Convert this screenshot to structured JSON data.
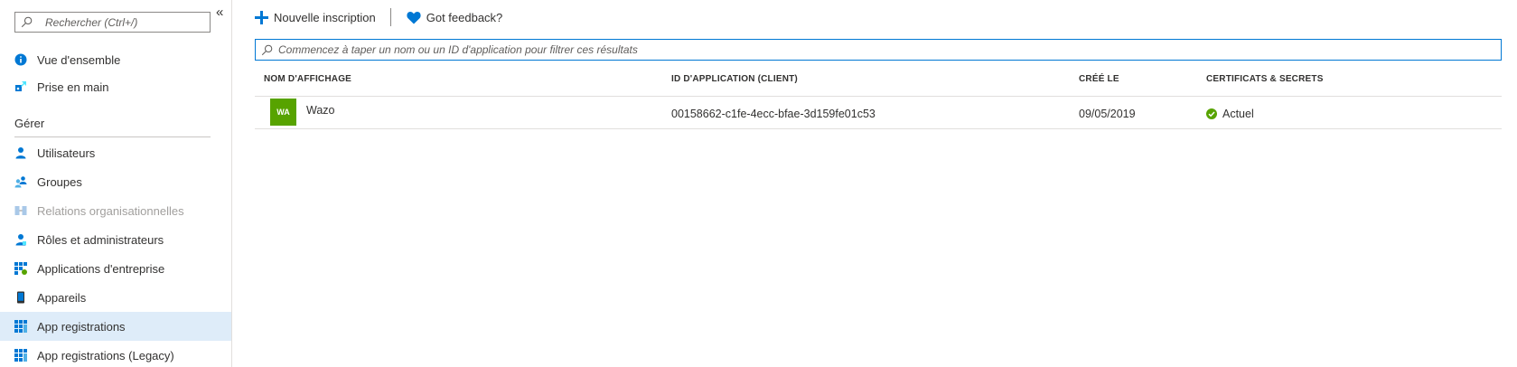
{
  "sidebar": {
    "search_placeholder": "Rechercher (Ctrl+/)",
    "collapse_glyph": "«",
    "top_items": [
      {
        "label": "Vue d'ensemble",
        "icon": "info-icon"
      },
      {
        "label": "Prise en main",
        "icon": "quickstart-icon"
      }
    ],
    "section_label": "Gérer",
    "items": [
      {
        "label": "Utilisateurs",
        "icon": "user-icon"
      },
      {
        "label": "Groupes",
        "icon": "group-icon"
      },
      {
        "label": "Relations organisationnelles",
        "icon": "org-relations-icon",
        "disabled": true
      },
      {
        "label": "Rôles et administrateurs",
        "icon": "roles-icon"
      },
      {
        "label": "Applications d'entreprise",
        "icon": "enterprise-apps-icon"
      },
      {
        "label": "Appareils",
        "icon": "device-icon"
      },
      {
        "label": "App registrations",
        "icon": "app-registrations-icon",
        "active": true
      },
      {
        "label": "App registrations (Legacy)",
        "icon": "app-registrations-legacy-icon"
      }
    ]
  },
  "toolbar": {
    "new_label": "Nouvelle inscription",
    "feedback_label": "Got feedback?"
  },
  "filter": {
    "placeholder": "Commencez à taper un nom ou un ID d'application pour filtrer ces résultats"
  },
  "table": {
    "columns": [
      "NOM D'AFFICHAGE",
      "ID D'APPLICATION (CLIENT)",
      "CRÉÉ LE",
      "CERTIFICATS & SECRETS"
    ],
    "rows": [
      {
        "badge": "WA",
        "name": "Wazo",
        "app_id": "00158662-c1fe-4ecc-bfae-3d159fe01c53",
        "created": "09/05/2019",
        "status": "Actuel"
      }
    ]
  },
  "colors": {
    "accent": "#0078d4",
    "active_bg": "#deecf9",
    "badge_green": "#57a300",
    "status_green": "#57a300"
  }
}
